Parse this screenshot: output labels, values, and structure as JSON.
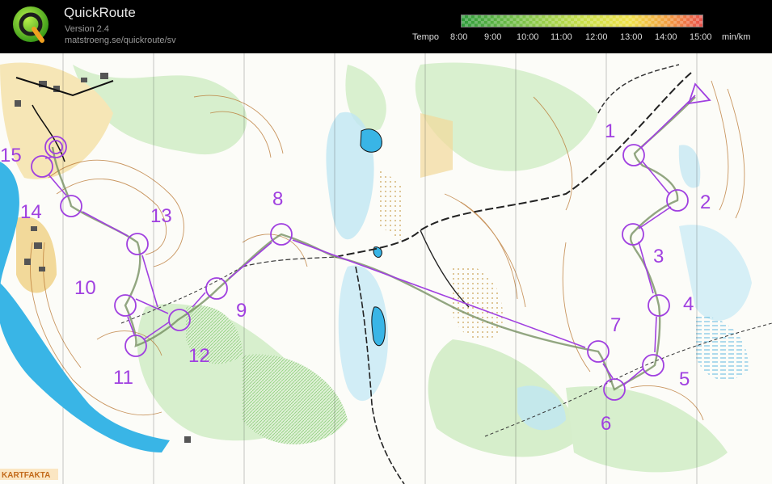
{
  "header": {
    "app_name": "QuickRoute",
    "version": "Version 2.4",
    "url": "matstroeng.se/quickroute/sv"
  },
  "pace_legend": {
    "label": "Tempo",
    "ticks": [
      "8:00",
      "9:00",
      "10:00",
      "11:00",
      "12:00",
      "13:00",
      "14:00",
      "15:00"
    ],
    "unit": "min/km",
    "colors": [
      "#2e9a3a",
      "#7cc24a",
      "#c8df4a",
      "#f0e14a",
      "#f2a040",
      "#e8504a"
    ]
  },
  "map": {
    "credit": "KARTFAKTA",
    "controls": [
      {
        "label": "1"
      },
      {
        "label": "2"
      },
      {
        "label": "3"
      },
      {
        "label": "4"
      },
      {
        "label": "5"
      },
      {
        "label": "6"
      },
      {
        "label": "7"
      },
      {
        "label": "8"
      },
      {
        "label": "9"
      },
      {
        "label": "10"
      },
      {
        "label": "11"
      },
      {
        "label": "12"
      },
      {
        "label": "13"
      },
      {
        "label": "14"
      },
      {
        "label": "15"
      }
    ],
    "course_color": "#a040e0"
  }
}
